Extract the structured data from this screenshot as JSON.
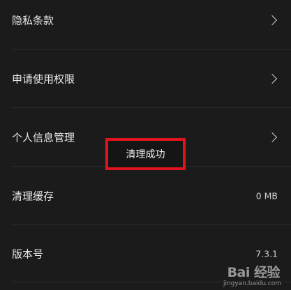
{
  "settings": {
    "items": [
      {
        "label": "隐私条款"
      },
      {
        "label": "申请使用权限"
      },
      {
        "label": "个人信息管理"
      },
      {
        "label": "清理缓存",
        "value": "0 MB"
      },
      {
        "label": "版本号",
        "value": "7.3.1"
      }
    ]
  },
  "toast": {
    "text": "清理成功"
  },
  "watermark": {
    "logo": "Bai 经验",
    "url": "jingyan.baidu.com"
  },
  "colors": {
    "background": "#1b1b1b",
    "highlight_border": "#e0141c"
  }
}
